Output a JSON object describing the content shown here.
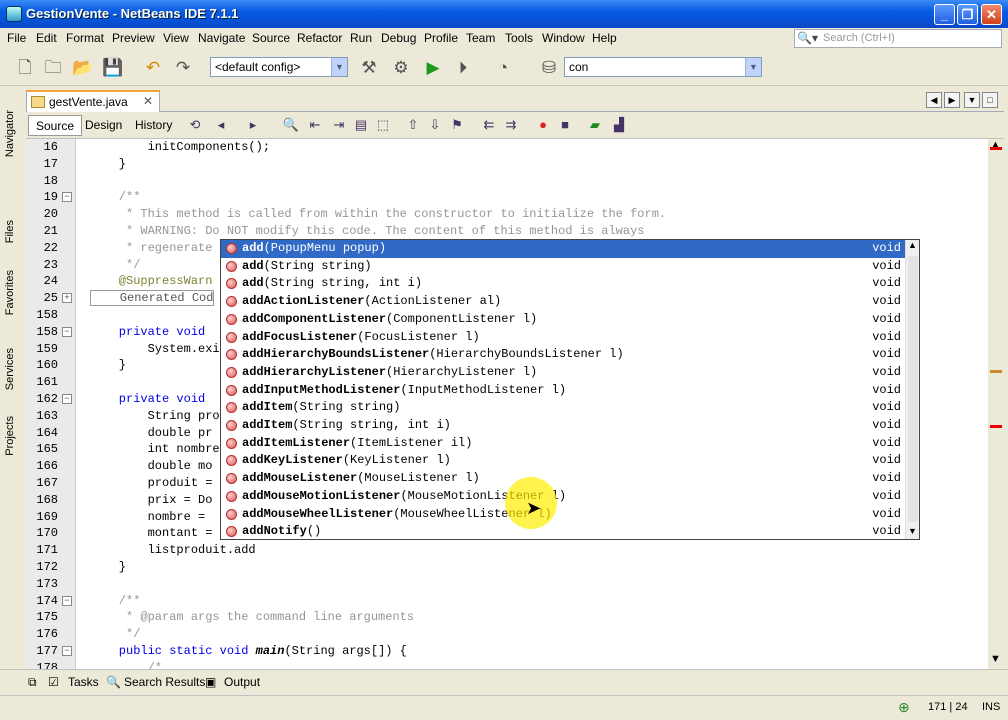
{
  "window": {
    "title": "GestionVente - NetBeans IDE 7.1.1"
  },
  "menu": [
    "File",
    "Edit",
    "Format",
    "Preview",
    "View",
    "Navigate",
    "Source",
    "Refactor",
    "Run",
    "Debug",
    "Profile",
    "Team",
    "Tools",
    "Window",
    "Help"
  ],
  "search": {
    "placeholder": "Search (Ctrl+I)"
  },
  "toolbar": {
    "config": "<default config>",
    "target": "con"
  },
  "side_tabs": [
    "Navigator",
    "Files",
    "Favorites",
    "Services",
    "Projects"
  ],
  "editor": {
    "file_tab": "gestVente.java",
    "view_tabs": [
      "Source",
      "Design",
      "History"
    ]
  },
  "code_lines": [
    {
      "n": "16",
      "t": "        initComponents();"
    },
    {
      "n": "17",
      "t": "    }"
    },
    {
      "n": "18",
      "t": ""
    },
    {
      "n": "19",
      "t": "    /**",
      "cls": "cm",
      "fold": "-"
    },
    {
      "n": "20",
      "t": "     * This method is called from within the constructor to initialize the form.",
      "cls": "cm"
    },
    {
      "n": "21",
      "t": "     * WARNING: Do NOT modify this code. The content of this method is always",
      "cls": "cm"
    },
    {
      "n": "22",
      "t": "     * regenerate",
      "cls": "cm"
    },
    {
      "n": "23",
      "t": "     */",
      "cls": "cm"
    },
    {
      "n": "24",
      "t": "    @SuppressWarn",
      "cls": "ann"
    },
    {
      "n": "25",
      "t": "    Generated Cod",
      "boxed": true,
      "fold": "+"
    },
    {
      "n": "158",
      "t": ""
    },
    {
      "n": "158",
      "t": "    private void ",
      "cls": "kw",
      "fold": "-"
    },
    {
      "n": "159",
      "t": "        System.exi"
    },
    {
      "n": "160",
      "t": "    }"
    },
    {
      "n": "161",
      "t": ""
    },
    {
      "n": "162",
      "t": "    private void ",
      "cls": "kw",
      "fold": "-"
    },
    {
      "n": "163",
      "t": "        String pro"
    },
    {
      "n": "164",
      "t": "        double pr"
    },
    {
      "n": "165",
      "t": "        int nombre"
    },
    {
      "n": "166",
      "t": "        double mo"
    },
    {
      "n": "167",
      "t": "        produit ="
    },
    {
      "n": "168",
      "t": "        prix = Do"
    },
    {
      "n": "169",
      "t": "        nombre ="
    },
    {
      "n": "170",
      "t": "        montant ="
    },
    {
      "n": "171",
      "t": "        listproduit.add"
    },
    {
      "n": "172",
      "t": "    }"
    },
    {
      "n": "173",
      "t": ""
    },
    {
      "n": "174",
      "t": "    /**",
      "cls": "cm",
      "fold": "-"
    },
    {
      "n": "175",
      "t": "     * @param args the command line arguments",
      "cls": "cm"
    },
    {
      "n": "176",
      "t": "     */",
      "cls": "cm"
    },
    {
      "n": "177",
      "t": "    public static void main(String args[]) {",
      "cls": "kw",
      "fold": "-"
    },
    {
      "n": "178",
      "t": "        /*",
      "cls": "cm"
    }
  ],
  "completion": [
    {
      "sig": "add(PopupMenu popup)",
      "ret": "void",
      "selected": true
    },
    {
      "sig": "add(String string)",
      "ret": "void"
    },
    {
      "sig": "add(String string, int i)",
      "ret": "void"
    },
    {
      "sig": "addActionListener(ActionListener al)",
      "ret": "void"
    },
    {
      "sig": "addComponentListener(ComponentListener l)",
      "ret": "void"
    },
    {
      "sig": "addFocusListener(FocusListener l)",
      "ret": "void"
    },
    {
      "sig": "addHierarchyBoundsListener(HierarchyBoundsListener l)",
      "ret": "void"
    },
    {
      "sig": "addHierarchyListener(HierarchyListener l)",
      "ret": "void"
    },
    {
      "sig": "addInputMethodListener(InputMethodListener l)",
      "ret": "void"
    },
    {
      "sig": "addItem(String string)",
      "ret": "void"
    },
    {
      "sig": "addItem(String string, int i)",
      "ret": "void"
    },
    {
      "sig": "addItemListener(ItemListener il)",
      "ret": "void"
    },
    {
      "sig": "addKeyListener(KeyListener l)",
      "ret": "void"
    },
    {
      "sig": "addMouseListener(MouseListener l)",
      "ret": "void"
    },
    {
      "sig": "addMouseMotionListener(MouseMotionListener l)",
      "ret": "void"
    },
    {
      "sig": "addMouseWheelListener(MouseWheelListener l)",
      "ret": "void"
    },
    {
      "sig": "addNotify()",
      "ret": "void"
    }
  ],
  "bottom_tabs": [
    "Tasks",
    "Search Results",
    "Output"
  ],
  "status": {
    "position": "171 | 24",
    "mode": "INS"
  }
}
